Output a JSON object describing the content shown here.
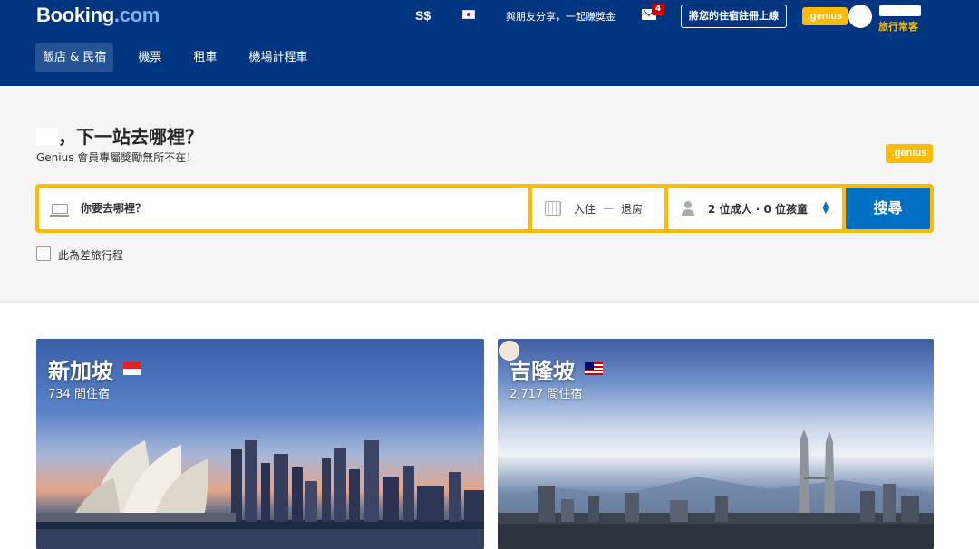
{
  "header": {
    "logo_main": "Booking",
    "logo_dot": ".com",
    "currency": "S$",
    "share": "與朋友分享，一起賺獎金",
    "mail_count": "4",
    "register_label": "將您的住宿註冊上線",
    "genius_label": ".genius",
    "user_level": "旅行常客"
  },
  "nav": {
    "tabs": [
      {
        "label": "飯店 & 民宿"
      },
      {
        "label": "機票"
      },
      {
        "label": "租車"
      },
      {
        "label": "機場計程車"
      }
    ]
  },
  "search": {
    "greeting": "，下一站去哪裡？",
    "subtitle": "Genius 會員專屬獎勵無所不在！",
    "genius_label": ".genius",
    "destination_placeholder": "你要去哪裡？",
    "checkin": "入住",
    "date_separator": "—",
    "checkout": "退房",
    "guests": "2 位成人 · 0 位孩童",
    "search_label": "搜尋",
    "business_label": "此為差旅行程"
  },
  "destinations": [
    {
      "name": "新加坡",
      "count": "734 間住宿"
    },
    {
      "name": "吉隆坡",
      "count": "2,717 間住宿"
    }
  ],
  "colors": {
    "brand_blue": "#003580",
    "accent_yellow": "#febb02",
    "button_blue": "#0071c2"
  }
}
